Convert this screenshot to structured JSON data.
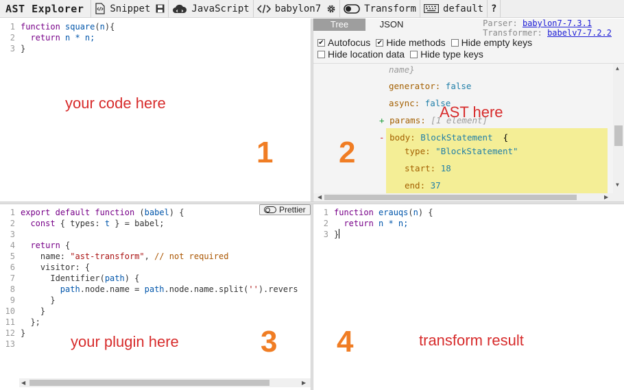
{
  "toolbar": {
    "title": "AST Explorer",
    "snippet_label": "Snippet",
    "language_label": "JavaScript",
    "parser_label": "babylon7",
    "transform_label": "Transform",
    "keymap_label": "default",
    "help_label": "?",
    "icons": [
      "snippet-icon",
      "save-icon",
      "cloud-icon",
      "code-icon",
      "gear-icon",
      "toggle-icon",
      "keyboard-icon"
    ]
  },
  "source_editor": {
    "lines": [
      {
        "n": "1",
        "tokens": [
          {
            "t": "function",
            "c": "kw"
          },
          {
            "t": " ",
            "c": ""
          },
          {
            "t": "square",
            "c": "fn"
          },
          {
            "t": "(",
            "c": ""
          },
          {
            "t": "n",
            "c": "var"
          },
          {
            "t": "){",
            "c": ""
          }
        ]
      },
      {
        "n": "2",
        "tokens": [
          {
            "t": "  ",
            "c": ""
          },
          {
            "t": "return",
            "c": "kw"
          },
          {
            "t": " n * n;",
            "c": "fnp"
          }
        ]
      },
      {
        "n": "3",
        "tokens": [
          {
            "t": "}",
            "c": ""
          }
        ]
      }
    ],
    "annotation": "your code here",
    "number": "1"
  },
  "ast_panel": {
    "tabs": [
      "Tree",
      "JSON"
    ],
    "parser_prefix": "Parser:",
    "parser_link": "babylon7-7.3.1",
    "transformer_prefix": "Transformer:",
    "transformer_link": "babelv7-7.2.2",
    "options": [
      {
        "label": "Autofocus",
        "checked": true
      },
      {
        "label": "Hide methods",
        "checked": true
      },
      {
        "label": "Hide empty keys",
        "checked": false
      },
      {
        "label": "Hide location data",
        "checked": false
      },
      {
        "label": "Hide type keys",
        "checked": false
      }
    ],
    "tree": {
      "name_tail": "name}",
      "generator_key": "generator:",
      "generator_val": "false",
      "async_key": "async:",
      "async_val": "false",
      "params_toggle": "+",
      "params_key": "params:",
      "params_val": "[1 element]",
      "body_toggle": "-",
      "body_key": "body:",
      "body_type": "BlockStatement",
      "body_brace": "{",
      "type_key": "type:",
      "type_val": "\"BlockStatement\"",
      "start_key": "start:",
      "start_val": "18",
      "end_key": "end:",
      "end_val": "37"
    },
    "annotation": "AST here",
    "number": "2"
  },
  "transform_editor": {
    "prettier_label": "Prettier",
    "lines": [
      {
        "n": "1",
        "tokens": [
          {
            "t": "export",
            "c": "kw"
          },
          {
            "t": " ",
            "c": ""
          },
          {
            "t": "default",
            "c": "kw"
          },
          {
            "t": " ",
            "c": ""
          },
          {
            "t": "function",
            "c": "kw"
          },
          {
            "t": " (",
            "c": ""
          },
          {
            "t": "babel",
            "c": "var"
          },
          {
            "t": ") {",
            "c": ""
          }
        ]
      },
      {
        "n": "2",
        "tokens": [
          {
            "t": "  ",
            "c": ""
          },
          {
            "t": "const",
            "c": "kw"
          },
          {
            "t": " { types: ",
            "c": ""
          },
          {
            "t": "t",
            "c": "var"
          },
          {
            "t": " } = babel;",
            "c": ""
          }
        ]
      },
      {
        "n": "3",
        "tokens": [
          {
            "t": "",
            "c": ""
          }
        ]
      },
      {
        "n": "4",
        "tokens": [
          {
            "t": "  ",
            "c": ""
          },
          {
            "t": "return",
            "c": "kw"
          },
          {
            "t": " {",
            "c": ""
          }
        ]
      },
      {
        "n": "5",
        "tokens": [
          {
            "t": "    name: ",
            "c": ""
          },
          {
            "t": "\"ast-transform\"",
            "c": "str"
          },
          {
            "t": ", ",
            "c": ""
          },
          {
            "t": "// not required",
            "c": "com"
          }
        ]
      },
      {
        "n": "6",
        "tokens": [
          {
            "t": "    visitor: {",
            "c": ""
          }
        ]
      },
      {
        "n": "7",
        "tokens": [
          {
            "t": "      Identifier(",
            "c": ""
          },
          {
            "t": "path",
            "c": "var"
          },
          {
            "t": ") {",
            "c": ""
          }
        ]
      },
      {
        "n": "8",
        "tokens": [
          {
            "t": "        ",
            "c": ""
          },
          {
            "t": "path",
            "c": "var"
          },
          {
            "t": ".node.name = ",
            "c": ""
          },
          {
            "t": "path",
            "c": "var"
          },
          {
            "t": ".node.name.split(",
            "c": ""
          },
          {
            "t": "''",
            "c": "str"
          },
          {
            "t": ").revers",
            "c": ""
          }
        ]
      },
      {
        "n": "9",
        "tokens": [
          {
            "t": "      }",
            "c": ""
          }
        ]
      },
      {
        "n": "10",
        "tokens": [
          {
            "t": "    }",
            "c": ""
          }
        ]
      },
      {
        "n": "11",
        "tokens": [
          {
            "t": "  };",
            "c": ""
          }
        ]
      },
      {
        "n": "12",
        "tokens": [
          {
            "t": "}",
            "c": ""
          }
        ]
      },
      {
        "n": "13",
        "tokens": [
          {
            "t": "",
            "c": ""
          }
        ]
      }
    ],
    "annotation": "your plugin here",
    "number": "3"
  },
  "output_editor": {
    "lines": [
      {
        "n": "1",
        "tokens": [
          {
            "t": "function",
            "c": "kw"
          },
          {
            "t": " ",
            "c": ""
          },
          {
            "t": "erauqs",
            "c": "fn"
          },
          {
            "t": "(",
            "c": ""
          },
          {
            "t": "n",
            "c": "var"
          },
          {
            "t": ") {",
            "c": ""
          }
        ]
      },
      {
        "n": "2",
        "tokens": [
          {
            "t": "  ",
            "c": ""
          },
          {
            "t": "return",
            "c": "kw"
          },
          {
            "t": " n * n;",
            "c": "fnp"
          }
        ]
      },
      {
        "n": "3",
        "tokens": [
          {
            "t": "}",
            "c": ""
          }
        ]
      }
    ],
    "annotation": "transform result",
    "number": "4"
  }
}
